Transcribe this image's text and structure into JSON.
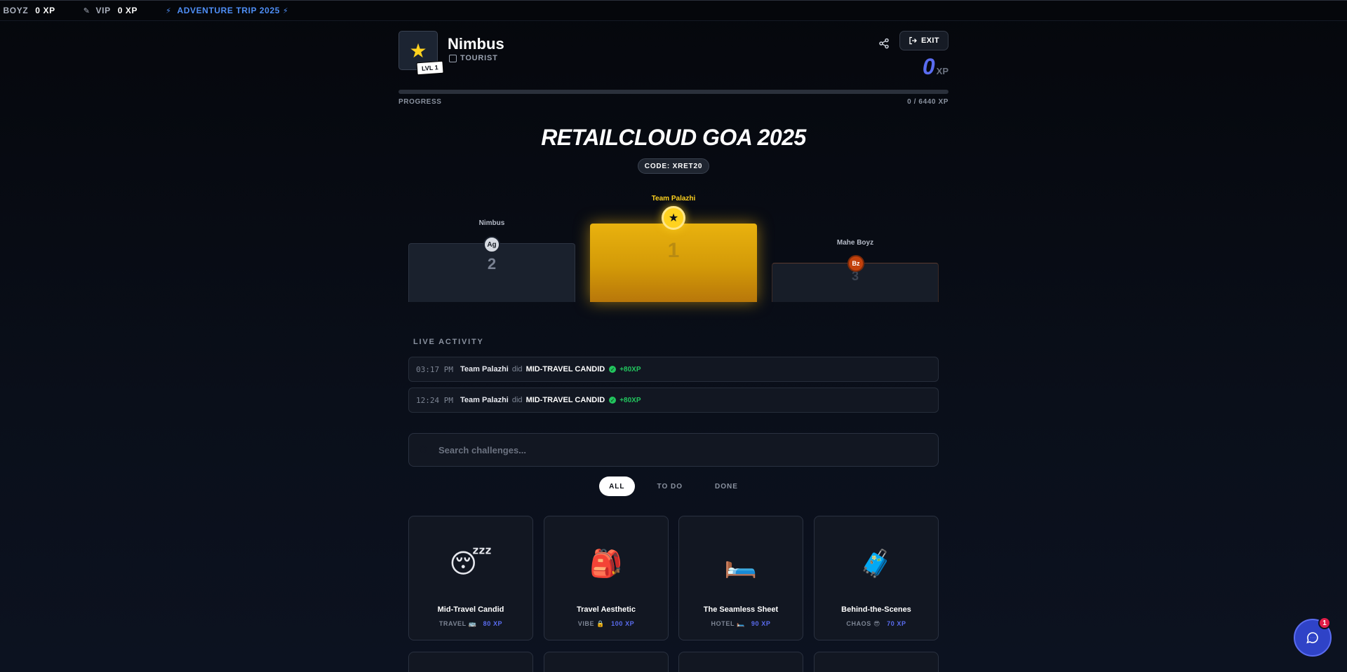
{
  "ticker": [
    {
      "name": "E BOYZ",
      "xp": "0 XP",
      "icon": "",
      "style": "plain"
    },
    {
      "name": "VIP",
      "xp": "0 XP",
      "icon": "✎",
      "style": "plain"
    },
    {
      "name": "ADVENTURE TRIP 2025",
      "xp": "",
      "icon": "⚡",
      "style": "blue"
    }
  ],
  "profile": {
    "name": "Nimbus",
    "role": "TOURIST",
    "level": "LVL 1",
    "avatar_icon": "star-icon",
    "exit_label": "EXIT",
    "xp_value": "0",
    "xp_unit": "XP"
  },
  "progress": {
    "label": "PROGRESS",
    "value_text": "0 / 6440 XP",
    "fraction": 0
  },
  "event": {
    "title": "RETAILCLOUD GOA 2025",
    "code": "CODE: XRET20"
  },
  "podium": {
    "first": {
      "name": "Team Palazhi",
      "rank": "1",
      "avatar": "★"
    },
    "second": {
      "name": "Nimbus",
      "rank": "2",
      "avatar": "Ag"
    },
    "third": {
      "name": "Mahe Boyz",
      "rank": "3",
      "avatar": "Bz"
    }
  },
  "live_activity": {
    "title": "LIVE ACTIVITY",
    "items": [
      {
        "time": "03:17 PM",
        "who": "Team Palazhi",
        "did": "did",
        "what": "MID-TRAVEL CANDID",
        "gain": "+80XP"
      },
      {
        "time": "12:24 PM",
        "who": "Team Palazhi",
        "did": "did",
        "what": "MID-TRAVEL CANDID",
        "gain": "+80XP"
      }
    ]
  },
  "search": {
    "placeholder": "Search challenges..."
  },
  "filters": [
    "ALL",
    "TO DO",
    "DONE"
  ],
  "challenges": [
    {
      "emoji": "😴",
      "title": "Mid-Travel Candid",
      "category": "TRAVEL",
      "cat_emoji": "🚌",
      "xp": "80 XP"
    },
    {
      "emoji": "🎒",
      "title": "Travel Aesthetic",
      "category": "VIBE",
      "cat_emoji": "🔒",
      "xp": "100 XP"
    },
    {
      "emoji": "🛏️",
      "title": "The Seamless Sheet",
      "category": "HOTEL",
      "cat_emoji": "🛏️",
      "xp": "90 XP"
    },
    {
      "emoji": "🧳",
      "title": "Behind-the-Scenes",
      "category": "CHAOS",
      "cat_emoji": "😎",
      "xp": "70 XP"
    }
  ],
  "chat": {
    "badge": "1"
  }
}
